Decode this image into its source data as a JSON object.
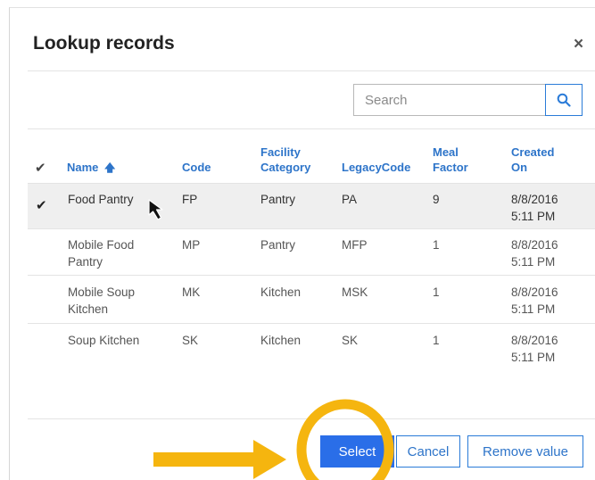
{
  "dialog": {
    "title": "Lookup records",
    "close_label": "×"
  },
  "search": {
    "placeholder": "Search",
    "value": ""
  },
  "table": {
    "check_mark": "✔",
    "columns": {
      "name": "Name",
      "name_sort_icon": "🡅",
      "code": "Code",
      "facility_category_line1": "Facility",
      "facility_category_line2": "Category",
      "legacy_code": "LegacyCode",
      "meal_factor_line1": "Meal",
      "meal_factor_line2": "Factor",
      "created_on_line1": "Created",
      "created_on_line2": "On"
    },
    "rows": [
      {
        "selected": true,
        "name_line1": "Food Pantry",
        "name_line2": "",
        "code": "FP",
        "category": "Pantry",
        "legacy": "PA",
        "meal": "9",
        "date": "8/8/2016",
        "time": "5:11 PM"
      },
      {
        "selected": false,
        "name_line1": "Mobile Food",
        "name_line2": "Pantry",
        "code": "MP",
        "category": "Pantry",
        "legacy": "MFP",
        "meal": "1",
        "date": "8/8/2016",
        "time": "5:11 PM"
      },
      {
        "selected": false,
        "name_line1": "Mobile Soup",
        "name_line2": "Kitchen",
        "code": "MK",
        "category": "Kitchen",
        "legacy": "MSK",
        "meal": "1",
        "date": "8/8/2016",
        "time": "5:11 PM"
      },
      {
        "selected": false,
        "name_line1": "Soup Kitchen",
        "name_line2": "",
        "code": "SK",
        "category": "Kitchen",
        "legacy": "SK",
        "meal": "1",
        "date": "8/8/2016",
        "time": "5:11 PM"
      }
    ]
  },
  "footer": {
    "select_label": "Select",
    "cancel_label": "Cancel",
    "remove_label": "Remove value"
  },
  "colors": {
    "accent": "#2d74c9",
    "primary_button": "#2a6ee8",
    "selected_row": "#efefef",
    "annotation": "#f5b50f"
  },
  "icons": {
    "search": "search-icon",
    "close": "close-icon",
    "sort": "sort-ascending-icon",
    "pointer": "mouse-pointer-icon",
    "annotation_arrow": "arrow-right-icon",
    "annotation_circle": "highlight-circle"
  }
}
